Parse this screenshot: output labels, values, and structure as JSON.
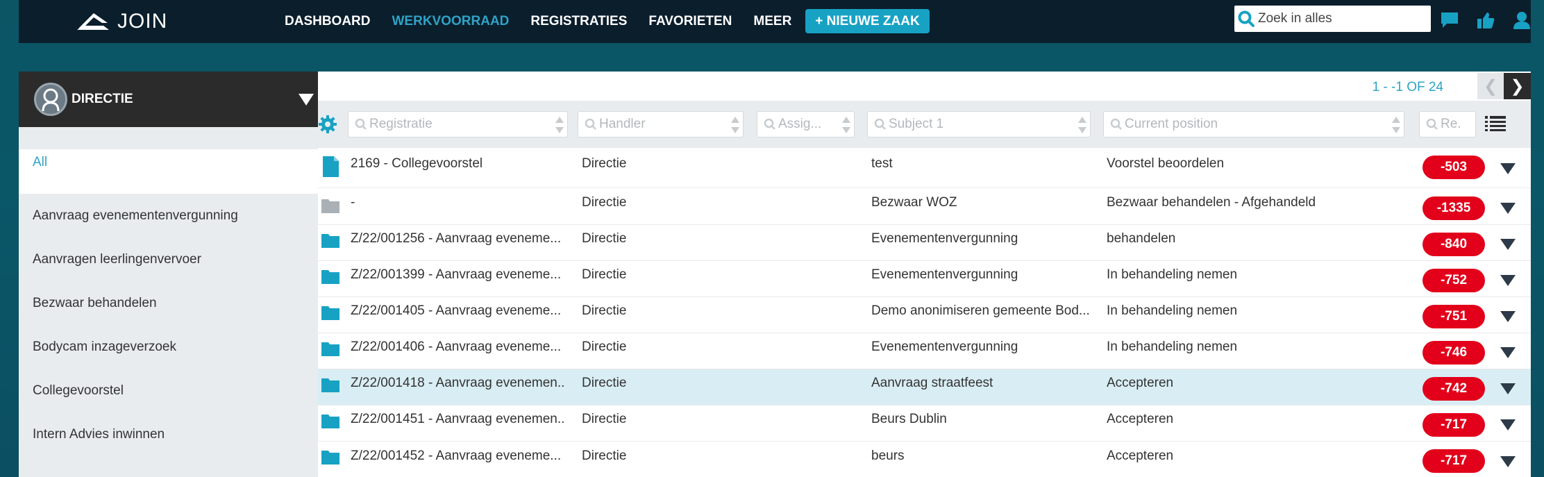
{
  "app": {
    "logo_text": "JOIN",
    "nav": [
      "DASHBOARD",
      "WERKVOORRAAD",
      "REGISTRATIES",
      "FAVORIETEN",
      "MEER"
    ],
    "active_nav": "WERKVOORRAAD",
    "new_case_label": "+ NIEUWE ZAAK",
    "search_placeholder": "Zoek in alles",
    "icons": [
      "chat-icon",
      "thumbs-up-icon",
      "user-icon"
    ],
    "accent_color": "#17a2c4"
  },
  "sidebar": {
    "title": "DIRECTIE",
    "items": [
      {
        "label": "All",
        "active": true
      },
      {
        "label": "Aanvraag evenementenvergunning",
        "active": false
      },
      {
        "label": "Aanvragen leerlingenvervoer",
        "active": false
      },
      {
        "label": "Bezwaar behandelen",
        "active": false
      },
      {
        "label": "Bodycam inzageverzoek",
        "active": false
      },
      {
        "label": "Collegevoorstel",
        "active": false
      },
      {
        "label": "Intern Advies inwinnen",
        "active": false
      }
    ]
  },
  "pager": {
    "text": "1 - -1 OF 24",
    "prev": "❮",
    "next": "❯"
  },
  "filters": {
    "registratie": "Registratie",
    "handler": "Handler",
    "assig": "Assig...",
    "subject": "Subject 1",
    "position": "Current position",
    "re": "Re..."
  },
  "rows": [
    {
      "icon": "document-icon",
      "registratie": "2169 - Collegevoorstel",
      "handler": "Directie",
      "subject": "test",
      "position": "Voorstel beoordelen",
      "badge": "-503",
      "highlight": false
    },
    {
      "icon": "folder-grey-icon",
      "registratie": "-",
      "handler": "Directie",
      "subject": "Bezwaar WOZ",
      "position": "Bezwaar behandelen - Afgehandeld",
      "badge": "-1335",
      "highlight": false
    },
    {
      "icon": "folder-icon",
      "registratie": "Z/22/001256 - Aanvraag eveneme...",
      "handler": "Directie",
      "subject": "Evenementenvergunning",
      "position": "behandelen",
      "badge": "-840",
      "highlight": false
    },
    {
      "icon": "folder-icon",
      "registratie": "Z/22/001399 - Aanvraag eveneme...",
      "handler": "Directie",
      "subject": "Evenementenvergunning",
      "position": "In behandeling nemen",
      "badge": "-752",
      "highlight": false
    },
    {
      "icon": "folder-icon",
      "registratie": "Z/22/001405 - Aanvraag eveneme...",
      "handler": "Directie",
      "subject": "Demo anonimiseren gemeente Bod...",
      "position": "In behandeling nemen",
      "badge": "-751",
      "highlight": false
    },
    {
      "icon": "folder-icon",
      "registratie": "Z/22/001406 - Aanvraag eveneme...",
      "handler": "Directie",
      "subject": "Evenementenvergunning",
      "position": "In behandeling nemen",
      "badge": "-746",
      "highlight": false
    },
    {
      "icon": "folder-icon",
      "registratie": "Z/22/001418 - Aanvraag evenemen...",
      "handler": "Directie",
      "subject": "Aanvraag straatfeest",
      "position": "Accepteren",
      "badge": "-742",
      "highlight": true
    },
    {
      "icon": "folder-icon",
      "registratie": "Z/22/001451 - Aanvraag evenemen...",
      "handler": "Directie",
      "subject": "Beurs Dublin",
      "position": "Accepteren",
      "badge": "-717",
      "highlight": false
    },
    {
      "icon": "folder-icon",
      "registratie": "Z/22/001452 - Aanvraag eveneme...",
      "handler": "Directie",
      "subject": "beurs",
      "position": "Accepteren",
      "badge": "-717",
      "highlight": false
    }
  ]
}
